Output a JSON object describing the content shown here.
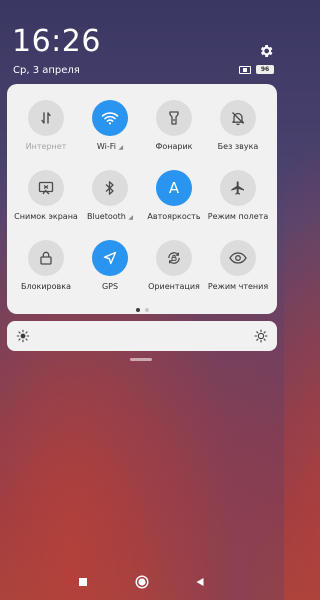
{
  "status": {
    "time": "16:26",
    "date": "Ср, 3 апреля",
    "battery": "96"
  },
  "tiles": [
    {
      "label": "Интернет",
      "icon": "mobile-data-icon",
      "active": false,
      "dim": true,
      "signal": false
    },
    {
      "label": "Wi-Fi",
      "icon": "wifi-icon",
      "active": true,
      "dim": false,
      "signal": true
    },
    {
      "label": "Фонарик",
      "icon": "flashlight-icon",
      "active": false,
      "dim": false,
      "signal": false
    },
    {
      "label": "Без звука",
      "icon": "bell-off-icon",
      "active": false,
      "dim": false,
      "signal": false
    },
    {
      "label": "Снимок экрана",
      "icon": "screenshot-icon",
      "active": false,
      "dim": false,
      "signal": false
    },
    {
      "label": "Bluetooth",
      "icon": "bluetooth-icon",
      "active": false,
      "dim": false,
      "signal": true
    },
    {
      "label": "Автояркость",
      "icon": "auto-brightness-icon",
      "active": true,
      "dim": false,
      "signal": false
    },
    {
      "label": "Режим полета",
      "icon": "airplane-icon",
      "active": false,
      "dim": false,
      "signal": false
    },
    {
      "label": "Блокировка",
      "icon": "lock-icon",
      "active": false,
      "dim": false,
      "signal": false
    },
    {
      "label": "GPS",
      "icon": "location-icon",
      "active": true,
      "dim": false,
      "signal": false
    },
    {
      "label": "Ориентация",
      "icon": "rotation-lock-icon",
      "active": false,
      "dim": false,
      "signal": false
    },
    {
      "label": "Режим чтения",
      "icon": "eye-icon",
      "active": false,
      "dim": false,
      "signal": false
    }
  ],
  "auto_brightness_letter": "A",
  "signal_glyph": "◢",
  "pages": {
    "count": 2,
    "current": 1
  },
  "colors": {
    "accent": "#2a95f0",
    "panel": "#f1f1f1",
    "tile_off": "#dcdcdc"
  }
}
